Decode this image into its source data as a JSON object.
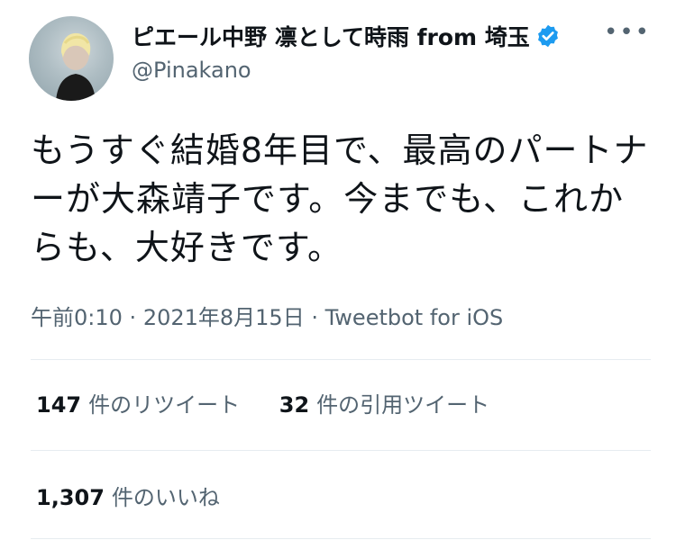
{
  "author": {
    "display_name": "ピエール中野 凛として時雨 from 埼玉",
    "handle": "@Pinakano"
  },
  "tweet": {
    "text": "もうすぐ結婚8年目で、最高のパートナーが大森靖子です。今までも、これからも、大好きです。"
  },
  "meta": {
    "time": "午前0:10",
    "date": "2021年8月15日",
    "client": "Tweetbot for iOS"
  },
  "stats": {
    "retweets_count": "147",
    "retweets_label": "件のリツイート",
    "quotes_count": "32",
    "quotes_label": "件の引用ツイート",
    "likes_count": "1,307",
    "likes_label": "件のいいね"
  },
  "icons": {
    "verified": "verified-badge-icon",
    "more": "more-dots-icon"
  },
  "colors": {
    "verified": "#1d9bf0",
    "secondary_text": "#536471",
    "primary_text": "#0f1419"
  }
}
